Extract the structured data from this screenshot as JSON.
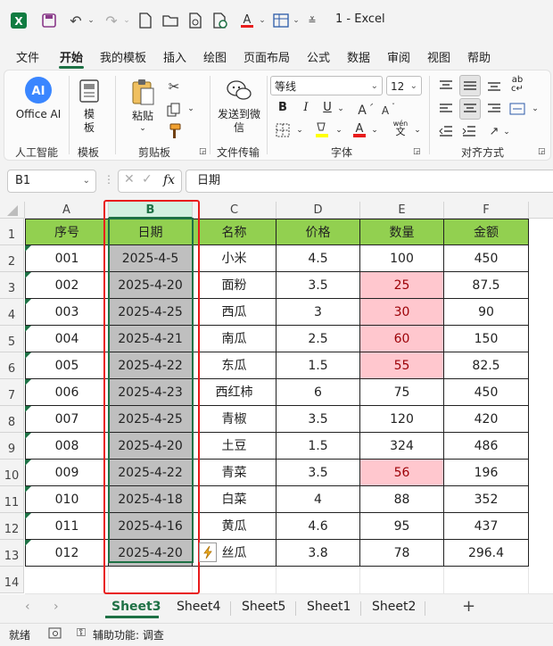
{
  "window": {
    "title": "1  -  Excel"
  },
  "menu": [
    "文件",
    "开始",
    "我的模板",
    "插入",
    "绘图",
    "页面布局",
    "公式",
    "数据",
    "审阅",
    "视图",
    "帮助"
  ],
  "ribbon": {
    "office_ai": "Office AI",
    "group_ai": "人工智能",
    "template_btn": "模板",
    "group_template": "模板",
    "paste_btn": "粘贴",
    "group_clipboard": "剪贴板",
    "send_btn": "发送到微信",
    "group_file_transfer": "文件传输",
    "font_name": "等线",
    "font_size": "12",
    "bold": "B",
    "italic": "I",
    "underline": "U",
    "wen": "wén",
    "group_font": "字体",
    "group_align": "对齐方式"
  },
  "formula_bar": {
    "name_box": "B1",
    "fx": "fx",
    "formula": "日期"
  },
  "grid": {
    "columns": [
      "A",
      "B",
      "C",
      "D",
      "E",
      "F"
    ],
    "rows": [
      "1",
      "2",
      "3",
      "4",
      "5",
      "6",
      "7",
      "8",
      "9",
      "10",
      "11",
      "12",
      "13",
      "14"
    ],
    "header": [
      "序号",
      "日期",
      "名称",
      "价格",
      "数量",
      "金额"
    ],
    "data": [
      [
        "001",
        "2025-4-5",
        "小米",
        "4.5",
        "100",
        "450"
      ],
      [
        "002",
        "2025-4-20",
        "面粉",
        "3.5",
        "25",
        "87.5"
      ],
      [
        "003",
        "2025-4-25",
        "西瓜",
        "3",
        "30",
        "90"
      ],
      [
        "004",
        "2025-4-21",
        "南瓜",
        "2.5",
        "60",
        "150"
      ],
      [
        "005",
        "2025-4-22",
        "东瓜",
        "1.5",
        "55",
        "82.5"
      ],
      [
        "006",
        "2025-4-23",
        "西红柿",
        "6",
        "75",
        "450"
      ],
      [
        "007",
        "2025-4-25",
        "青椒",
        "3.5",
        "120",
        "420"
      ],
      [
        "008",
        "2025-4-20",
        "土豆",
        "1.5",
        "324",
        "486"
      ],
      [
        "009",
        "2025-4-22",
        "青菜",
        "3.5",
        "56",
        "196"
      ],
      [
        "010",
        "2025-4-18",
        "白菜",
        "4",
        "88",
        "352"
      ],
      [
        "011",
        "2025-4-16",
        "黄瓜",
        "4.6",
        "95",
        "437"
      ],
      [
        "012",
        "2025-4-20",
        "丝瓜",
        "3.8",
        "78",
        "296.4"
      ]
    ],
    "highlight_color": "#ffc7ce",
    "header_color": "#92d050"
  },
  "sheets": [
    "Sheet3",
    "Sheet4",
    "Sheet5",
    "Sheet1",
    "Sheet2"
  ],
  "status": {
    "ready": "就绪",
    "accessibility": "辅助功能: 调查"
  }
}
